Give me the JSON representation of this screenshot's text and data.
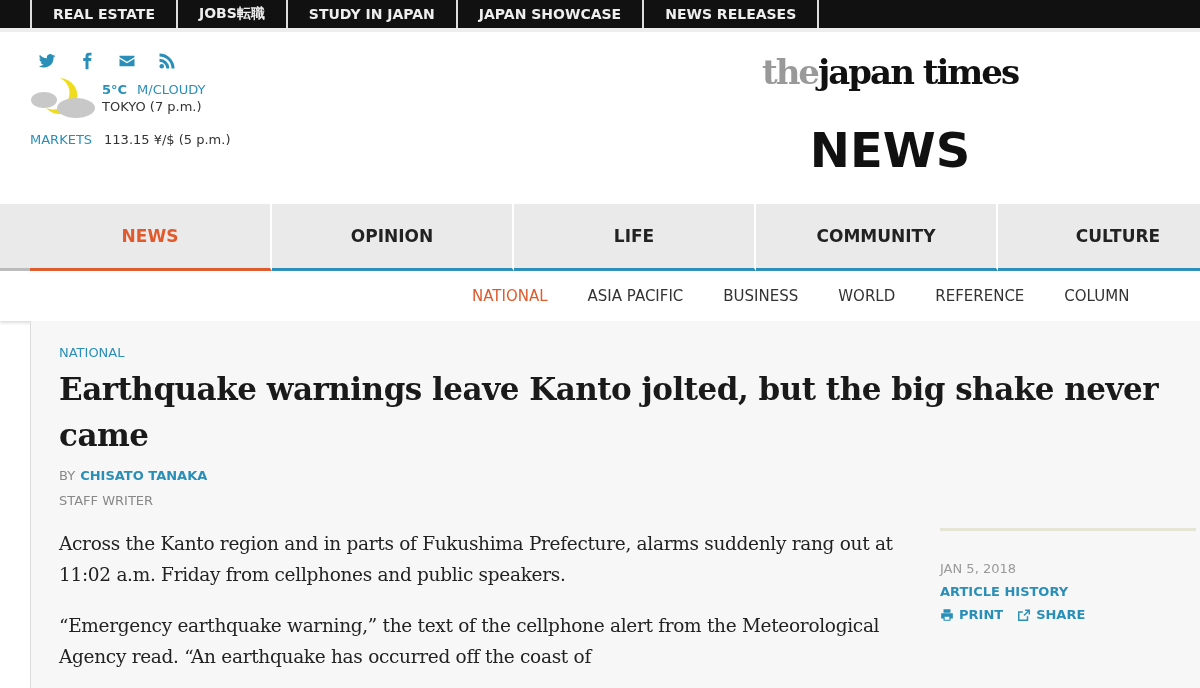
{
  "top_nav": [
    {
      "label": "REAL ESTATE"
    },
    {
      "label": "JOBS転職"
    },
    {
      "label": "STUDY IN JAPAN"
    },
    {
      "label": "JAPAN SHOWCASE"
    },
    {
      "label": "NEWS RELEASES"
    }
  ],
  "social_icons": [
    {
      "kind": "twitter"
    },
    {
      "kind": "facebook"
    },
    {
      "kind": "mail"
    },
    {
      "kind": "rss"
    }
  ],
  "weather": {
    "temperature": "5°C",
    "condition": "M/CLOUDY",
    "location": "TOKYO (7 p.m.)"
  },
  "markets": {
    "label": "MARKETS",
    "value": "113.15 ¥/$ (5 p.m.)"
  },
  "logo": {
    "prefix": "the",
    "name": "japan times"
  },
  "section_title": "NEWS",
  "sections": [
    {
      "label": "NEWS",
      "selected": true
    },
    {
      "label": "OPINION",
      "selected": false
    },
    {
      "label": "LIFE",
      "selected": false
    },
    {
      "label": "COMMUNITY",
      "selected": false
    },
    {
      "label": "CULTURE",
      "selected": false
    }
  ],
  "subsections": [
    {
      "label": "NATIONAL",
      "selected": true
    },
    {
      "label": "ASIA PACIFIC",
      "selected": false
    },
    {
      "label": "BUSINESS",
      "selected": false
    },
    {
      "label": "WORLD",
      "selected": false
    },
    {
      "label": "REFERENCE",
      "selected": false
    },
    {
      "label": "COLUMN",
      "selected": false
    }
  ],
  "article": {
    "category": "NATIONAL",
    "headline": "Earthquake warnings leave Kanto jolted, but the big shake never came",
    "byline_prefix": "BY",
    "author": "CHISATO TANAKA",
    "role": "STAFF WRITER",
    "paragraphs": [
      "Across the Kanto region and in parts of Fukushima Prefecture, alarms suddenly rang out at 11:02 a.m. Friday from cellphones and public speakers.",
      "“Emergency earthquake warning,” the text of the cellphone alert from the Meteorological Agency read. “An earthquake has occurred off the coast of"
    ]
  },
  "sidebar": {
    "date": "JAN 5, 2018",
    "history_link": "ARTICLE HISTORY",
    "actions": [
      {
        "kind": "print",
        "label": "PRINT"
      },
      {
        "kind": "share",
        "label": "SHARE"
      }
    ]
  }
}
